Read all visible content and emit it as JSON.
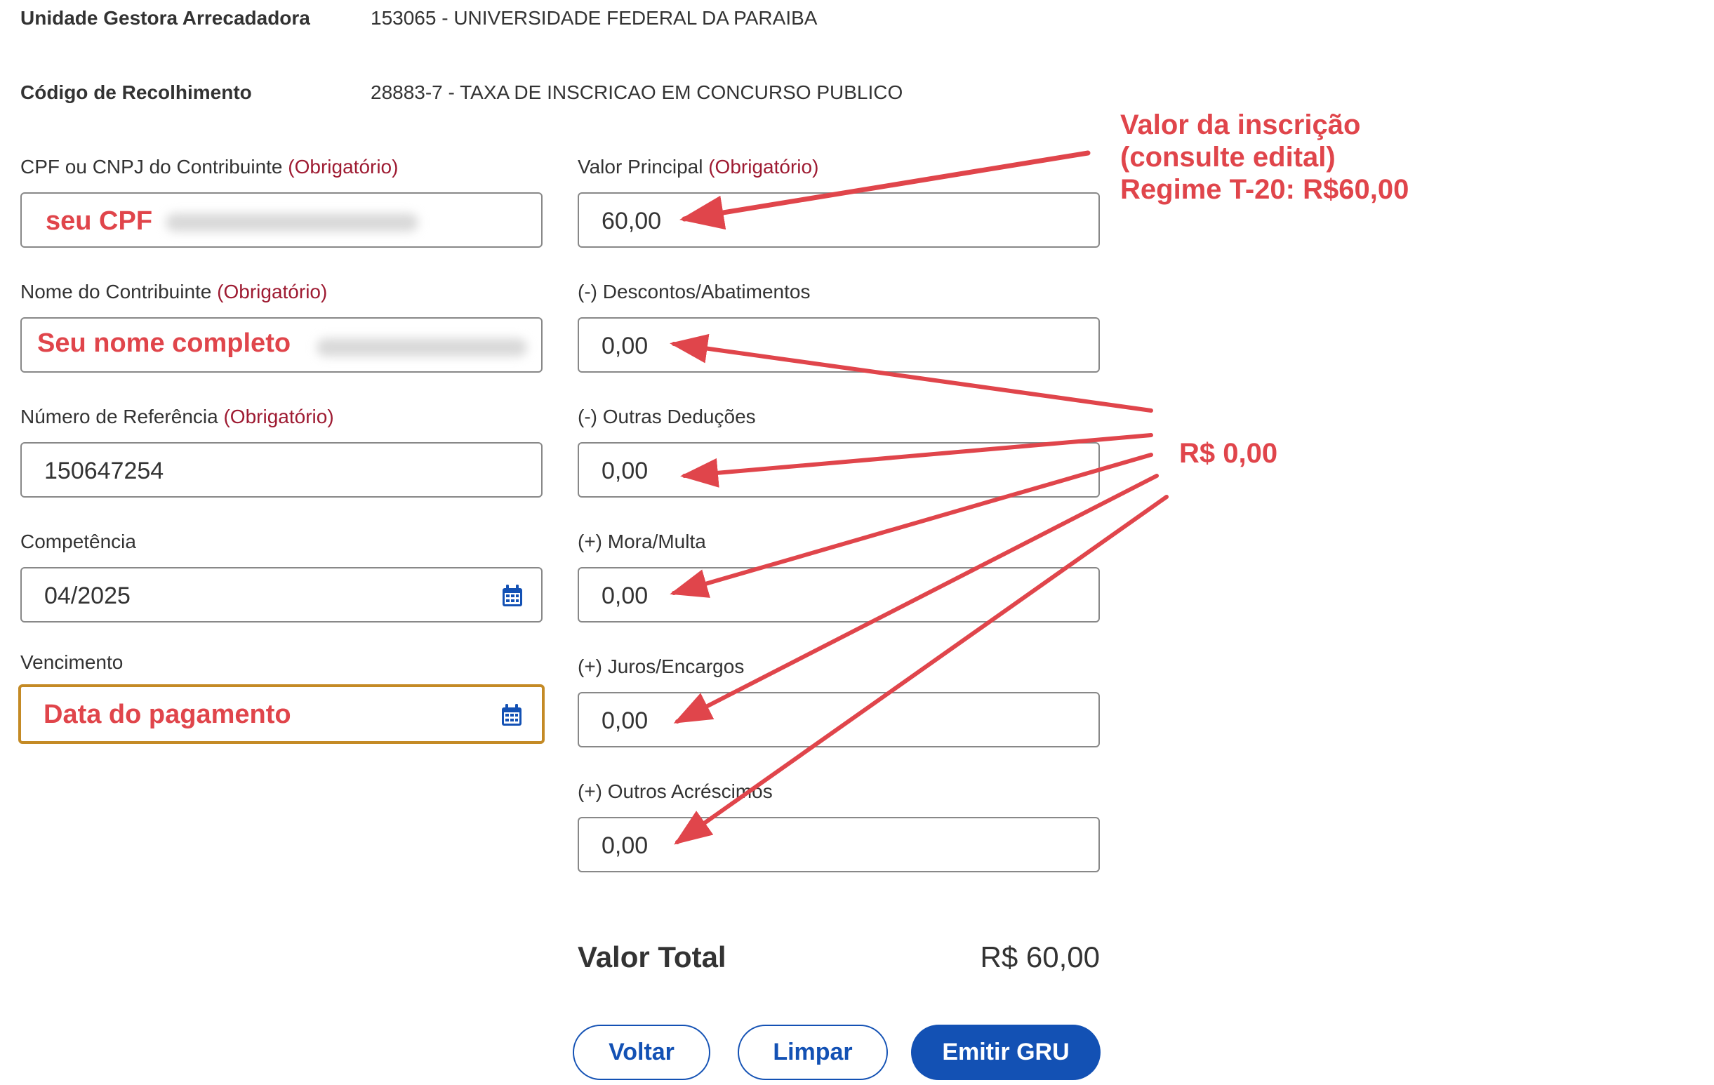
{
  "info": {
    "ug_label": "Unidade Gestora Arrecadadora",
    "ug_value": "153065 - UNIVERSIDADE FEDERAL DA PARAIBA",
    "cod_label": "Código de Recolhimento",
    "cod_value": "28883-7 - TAXA DE INSCRICAO EM CONCURSO PUBLICO"
  },
  "left": {
    "cpf": {
      "label": "CPF ou CNPJ do Contribuinte",
      "required": "(Obrigatório)",
      "annotation": "seu CPF"
    },
    "nome": {
      "label": "Nome do Contribuinte",
      "required": "(Obrigatório)",
      "annotation": "Seu nome completo"
    },
    "ref": {
      "label": "Número de Referência",
      "required": "(Obrigatório)",
      "value": "150647254"
    },
    "comp": {
      "label": "Competência",
      "value": "04/2025"
    },
    "venc": {
      "label": "Vencimento",
      "annotation": "Data do pagamento"
    }
  },
  "right": {
    "principal": {
      "label": "Valor Principal",
      "required": "(Obrigatório)",
      "value": "60,00"
    },
    "descontos": {
      "label": "(-) Descontos/Abatimentos",
      "value": "0,00"
    },
    "deducoes": {
      "label": "(-) Outras Deduções",
      "value": "0,00"
    },
    "mora": {
      "label": "(+) Mora/Multa",
      "value": "0,00"
    },
    "juros": {
      "label": "(+) Juros/Encargos",
      "value": "0,00"
    },
    "acrescimos": {
      "label": "(+) Outros Acréscimos",
      "value": "0,00"
    }
  },
  "total": {
    "label": "Valor Total",
    "value": "R$ 60,00"
  },
  "buttons": {
    "voltar": "Voltar",
    "limpar": "Limpar",
    "emitir": "Emitir GRU"
  },
  "annotations": {
    "valor_line1": "Valor da inscrição",
    "valor_line2": "(consulte edital)",
    "valor_line3": "Regime T-20: R$60,00",
    "zero": "R$ 0,00",
    "color": "#e0454b"
  },
  "icons": {
    "calendar": "calendar-icon"
  },
  "colors": {
    "primary": "#1351b4",
    "required": "#9e1b32",
    "focus": "#c48a25"
  }
}
